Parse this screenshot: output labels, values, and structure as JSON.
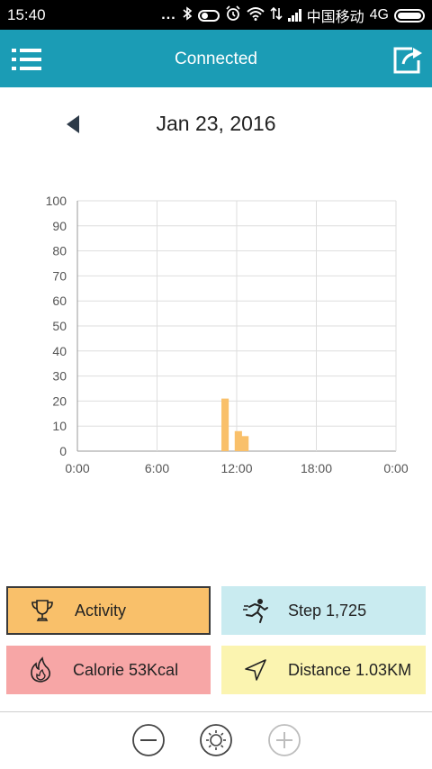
{
  "status_bar": {
    "time": "15:40",
    "dots": "...",
    "carrier": "中国移动",
    "network": "4G"
  },
  "app_bar": {
    "title": "Connected",
    "menu_icon": "menu-list-icon",
    "share_icon": "share-icon"
  },
  "date": {
    "label": "Jan 23, 2016",
    "prev_icon": "triangle-left-icon"
  },
  "chart_data": {
    "type": "bar",
    "x_tick_labels": [
      "0:00",
      "6:00",
      "12:00",
      "18:00",
      "0:00"
    ],
    "y_ticks": [
      0,
      10,
      20,
      30,
      40,
      50,
      60,
      70,
      80,
      90,
      100
    ],
    "ylim": [
      0,
      100
    ],
    "x_range_hours": [
      0,
      24
    ],
    "bar_color": "#f9c06a",
    "bars": [
      {
        "hour": 11,
        "value": 21
      },
      {
        "hour": 12,
        "value": 8
      },
      {
        "hour": 12.5,
        "value": 6
      }
    ],
    "grid": true
  },
  "cards": {
    "activity": {
      "label": "Activity",
      "color": "#f9c06a",
      "icon": "trophy-icon"
    },
    "step": {
      "label": "Step 1,725",
      "color": "#c9ebf0",
      "icon": "runner-icon"
    },
    "calorie": {
      "label": "Calorie 53Kcal",
      "color": "#f7a6a6",
      "icon": "flame-icon"
    },
    "distance": {
      "label": "Distance 1.03KM",
      "color": "#fbf4b0",
      "icon": "navigation-arrow-icon"
    }
  },
  "bottom_bar": {
    "zoom_out_icon": "minus-circle-icon",
    "settings_icon": "brightness-icon",
    "zoom_in_icon": "plus-circle-icon"
  },
  "colors": {
    "app_bar": "#1b9cb5",
    "status_bar": "#000000"
  }
}
